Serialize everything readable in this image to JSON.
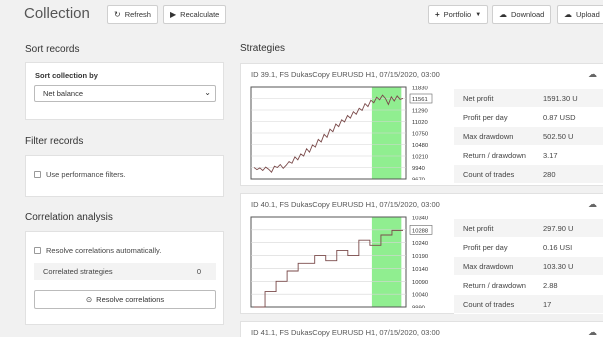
{
  "header": {
    "title": "Collection",
    "refresh_label": "Refresh",
    "recalculate_label": "Recalculate",
    "portfolio_label": "Portfolio",
    "download_label": "Download",
    "upload_label": "Upload"
  },
  "sort": {
    "heading": "Sort records",
    "label": "Sort collection by",
    "selected": "Net balance"
  },
  "filter": {
    "heading": "Filter records",
    "checkbox_label": "Use performance filters."
  },
  "correlation": {
    "heading": "Correlation analysis",
    "checkbox_label": "Resolve correlations automatically.",
    "row_label": "Correlated strategies",
    "row_value": "0",
    "button_label": "Resolve correlations"
  },
  "strategies": {
    "heading": "Strategies",
    "cards": [
      {
        "header": "ID 39.1, FS DukasCopy EURUSD H1, 07/15/2020, 03:00",
        "stats": [
          {
            "label": "Net profit",
            "value": "1591.30 U"
          },
          {
            "label": "Profit per day",
            "value": "0.87 USD"
          },
          {
            "label": "Max drawdown",
            "value": "502.50 U"
          },
          {
            "label": "Return / drawdown",
            "value": "3.17"
          },
          {
            "label": "Count of trades",
            "value": "280"
          }
        ],
        "ticks": [
          "11830",
          "11561",
          "11290",
          "11020",
          "10750",
          "10480",
          "10210",
          "9940",
          "9670"
        ],
        "last_value_label": "11561"
      },
      {
        "header": "ID 40.1, FS DukasCopy EURUSD H1, 07/15/2020, 03:00",
        "stats": [
          {
            "label": "Net profit",
            "value": "297.90 U"
          },
          {
            "label": "Profit per day",
            "value": "0.16 USI"
          },
          {
            "label": "Max drawdown",
            "value": "103.30 U"
          },
          {
            "label": "Return / drawdown",
            "value": "2.88"
          },
          {
            "label": "Count of trades",
            "value": "17"
          }
        ],
        "ticks": [
          "10340",
          "10288",
          "10240",
          "10190",
          "10140",
          "10090",
          "10040",
          "9990"
        ],
        "last_value_label": "10288"
      },
      {
        "header": "ID 41.1, FS DukasCopy EURUSD H1, 07/15/2020, 03:00"
      }
    ]
  },
  "chart_data": [
    {
      "type": "line",
      "ylim": [
        9670,
        11830
      ],
      "y": [
        9940,
        9890,
        9930,
        9870,
        9950,
        9900,
        9830,
        9970,
        9940,
        10010,
        9920,
        9990,
        10080,
        10040,
        10190,
        10120,
        10260,
        10210,
        10380,
        10300,
        10470,
        10420,
        10600,
        10540,
        10720,
        10650,
        10840,
        10780,
        10960,
        10900,
        11060,
        11010,
        11160,
        11100,
        11250,
        11190,
        11330,
        11280,
        11440,
        11370,
        11520,
        11460,
        11590,
        11530,
        11640,
        11560,
        11420,
        11600,
        11500,
        11620,
        11540,
        11561
      ],
      "highlight_fraction": [
        0.78,
        0.97
      ],
      "colors": {
        "line": "#7a4a4a",
        "highlight": "#90ee90",
        "grid": "#d6d6d6"
      }
    },
    {
      "type": "line",
      "step": true,
      "ylim": [
        9990,
        10340
      ],
      "y": [
        9990,
        9990,
        10050,
        10050,
        10090,
        10090,
        10130,
        10130,
        10160,
        10160,
        10160,
        10190,
        10190,
        10170,
        10170,
        10210,
        10210,
        10190,
        10190,
        10250,
        10250,
        10230,
        10230,
        10270,
        10270,
        10288,
        10288,
        10288
      ],
      "highlight_fraction": [
        0.78,
        0.97
      ],
      "colors": {
        "line": "#7a4a4a",
        "highlight": "#90ee90",
        "grid": "#d6d6d6"
      }
    }
  ]
}
